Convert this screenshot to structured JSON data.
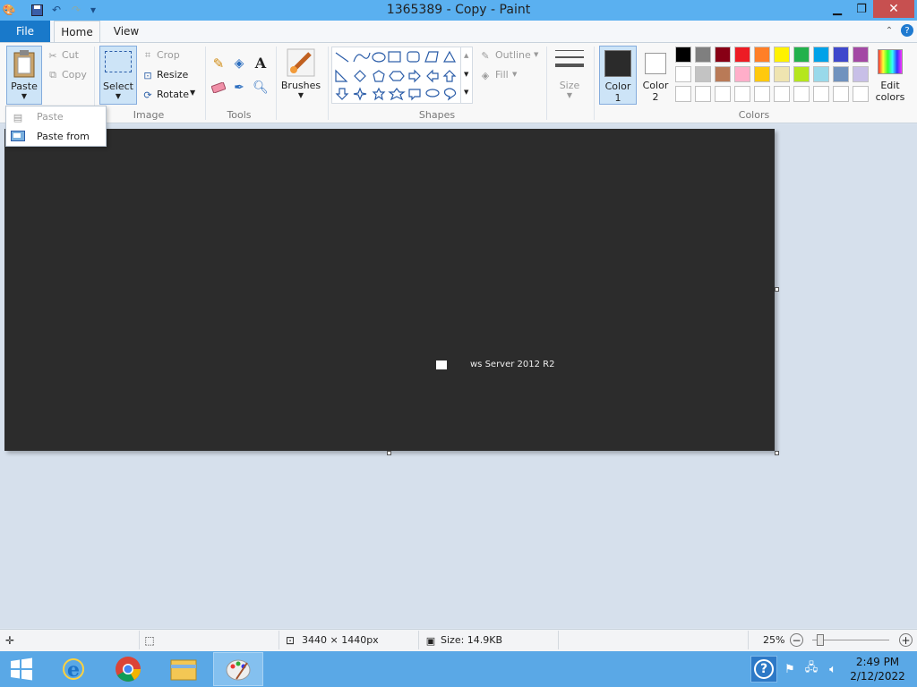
{
  "window": {
    "title": "1365389 - Copy - Paint",
    "min_icon": "minimize-icon",
    "max_icon": "restore-icon",
    "close_icon": "close-icon"
  },
  "tabs": {
    "file": "File",
    "home": "Home",
    "view": "View"
  },
  "clipboard": {
    "paste": "Paste",
    "cut": "Cut",
    "copy": "Copy"
  },
  "image": {
    "select": "Select",
    "crop": "Crop",
    "resize": "Resize",
    "rotate": "Rotate",
    "label": "Image"
  },
  "tools": {
    "label": "Tools"
  },
  "brushes": {
    "label": "Brushes"
  },
  "shapes": {
    "outline": "Outline",
    "fill": "Fill",
    "label": "Shapes"
  },
  "size": {
    "label": "Size"
  },
  "color1": {
    "line1": "Color",
    "line2": "1",
    "value": "#2b2b2b"
  },
  "color2": {
    "line1": "Color",
    "line2": "2",
    "value": "#ffffff"
  },
  "colors": {
    "label": "Colors",
    "edit_line1": "Edit",
    "edit_line2": "colors",
    "row1": [
      "#000000",
      "#7f7f7f",
      "#880015",
      "#ed1c24",
      "#ff7f27",
      "#fff200",
      "#22b14c",
      "#00a2e8",
      "#3f48cc",
      "#a349a4"
    ],
    "row2": [
      "#ffffff",
      "#c3c3c3",
      "#b97a57",
      "#ffaec9",
      "#ffc90e",
      "#efe4b0",
      "#b5e61d",
      "#99d9ea",
      "#7092be",
      "#c8bfe7"
    ],
    "row3": [
      "#ffffff",
      "#ffffff",
      "#ffffff",
      "#ffffff",
      "#ffffff",
      "#ffffff",
      "#ffffff",
      "#ffffff",
      "#ffffff",
      "#ffffff"
    ]
  },
  "paste_menu": {
    "paste": "Paste",
    "paste_from": "Paste from"
  },
  "canvas_text": "ws Server 2012 R2",
  "status": {
    "dimensions": "3440 × 1440px",
    "size": "Size: 14.9KB",
    "zoom": "25%"
  },
  "taskbar": {
    "time": "2:49 PM",
    "date": "2/12/2022"
  }
}
